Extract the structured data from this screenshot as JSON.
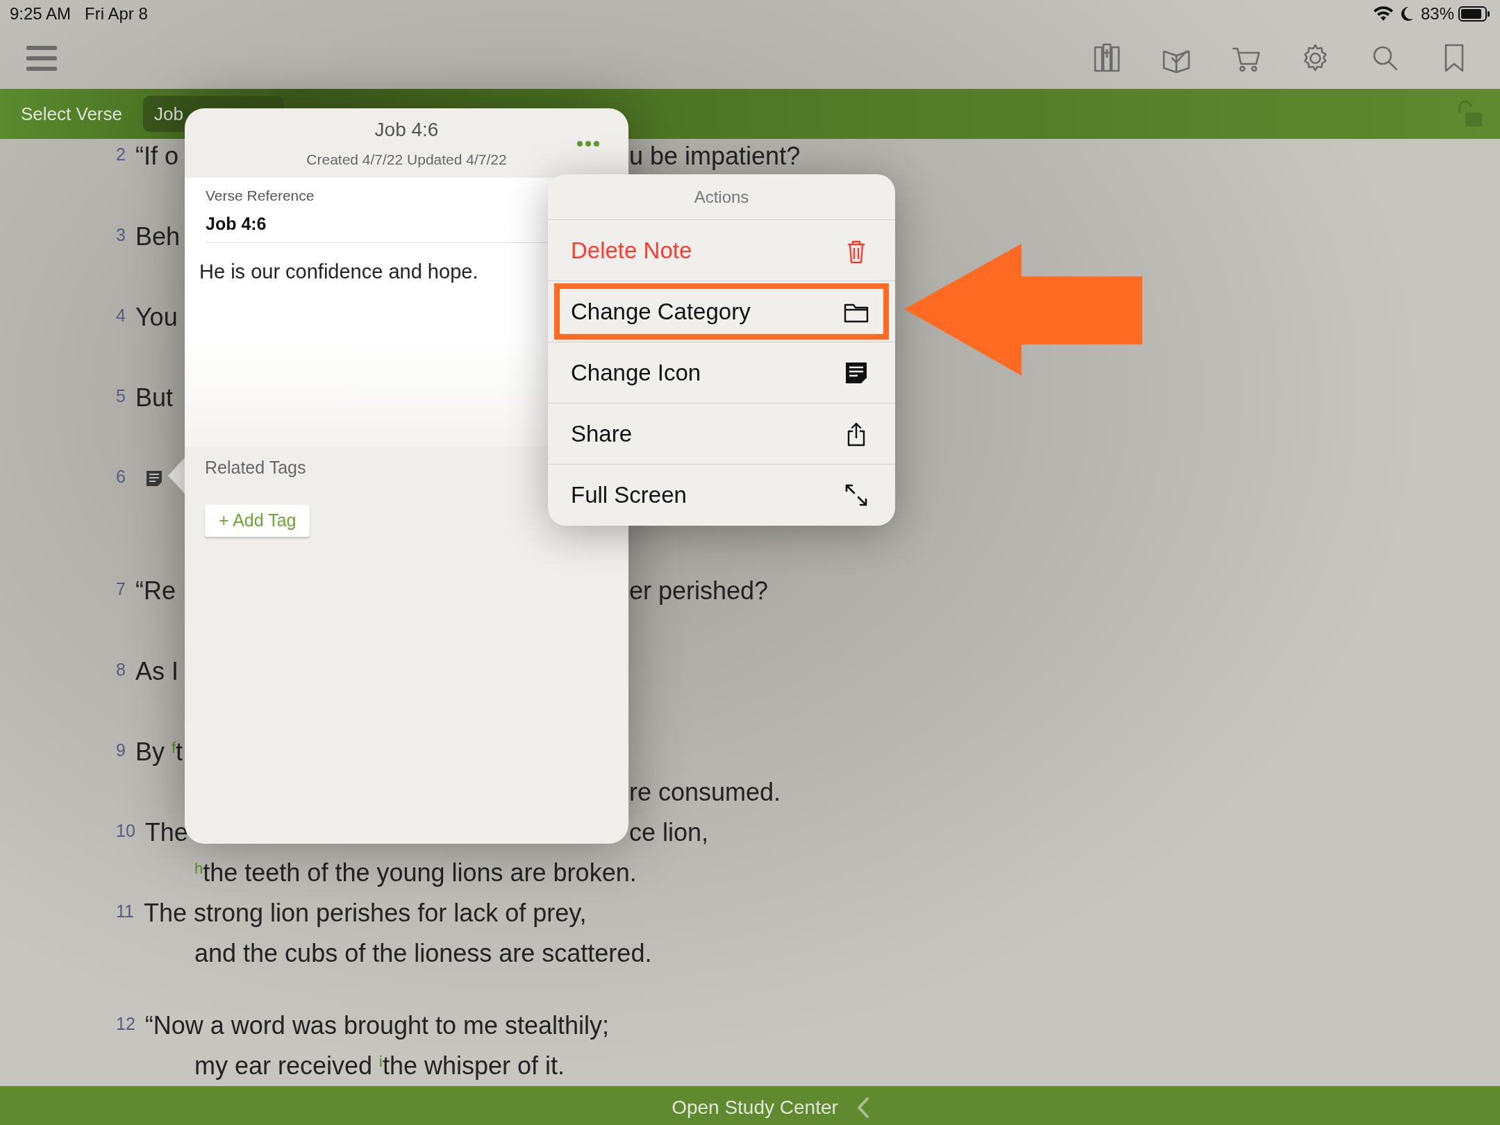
{
  "status_bar": {
    "time": "9:25 AM",
    "date": "Fri Apr 8",
    "battery_text": "83%"
  },
  "nav_bar": {
    "select_verse": "Select Verse",
    "reference_pill": "Job"
  },
  "stanzas": [
    {
      "verses": [
        {
          "number": "2",
          "note": false,
          "lines": [
            {
              "left": "“If o",
              "right": "u be impatient?"
            }
          ]
        },
        {
          "number": "3",
          "note": false,
          "lines": [
            {
              "left": "Beh"
            }
          ]
        },
        {
          "number": "4",
          "note": false,
          "lines": [
            {
              "left": "You"
            }
          ]
        },
        {
          "number": "5",
          "note": false,
          "lines": [
            {
              "left": "But"
            }
          ]
        },
        {
          "number": "6",
          "note": true
        }
      ]
    },
    {
      "verses": [
        {
          "number": "7",
          "note": false,
          "lines": [
            {
              "left": "“Re",
              "right": "er perished?"
            }
          ]
        },
        {
          "number": "8",
          "note": false,
          "lines": [
            {
              "left": "As I"
            }
          ]
        },
        {
          "number": "9",
          "note": false,
          "lines": [
            {
              "left": "By $^{f}$t"
            },
            {
              "right": "re consumed."
            }
          ]
        },
        {
          "number": "10",
          "note": false,
          "lines": [
            {
              "left": "The",
              "right": "ce lion,"
            },
            {
              "left": "$^{h}$the teeth of the young lions are broken."
            }
          ]
        },
        {
          "number": "11",
          "note": false,
          "lines": [
            {
              "left": "The strong lion perishes for lack of prey,"
            },
            {
              "left": "and the cubs of the lioness are scattered."
            }
          ]
        }
      ]
    },
    {
      "verses": [
        {
          "number": "12",
          "note": false,
          "lines": [
            {
              "left": "“Now a word was brought to me stealthily;"
            },
            {
              "left": "my ear received $^{i}$the whisper of it."
            }
          ]
        }
      ]
    }
  ],
  "note_popover": {
    "title": "Job 4:6",
    "dates": "Created 4/7/22 Updated 4/7/22",
    "verse_reference_label": "Verse Reference",
    "verse_reference": "Job 4:6",
    "body": "He is our confidence and hope.",
    "related_tags_label": "Related Tags",
    "add_tag_button": "+ Add Tag"
  },
  "actions_menu": {
    "title": "Actions",
    "items": [
      {
        "label": "Delete Note",
        "destructive": true,
        "highlighted": false
      },
      {
        "label": "Change Category",
        "destructive": false,
        "highlighted": true
      },
      {
        "label": "Change Icon",
        "destructive": false,
        "highlighted": false
      },
      {
        "label": "Share",
        "destructive": false,
        "highlighted": false
      },
      {
        "label": "Full Screen",
        "destructive": false,
        "highlighted": false
      }
    ]
  },
  "bottom_bar": {
    "label": "Open Study Center"
  }
}
